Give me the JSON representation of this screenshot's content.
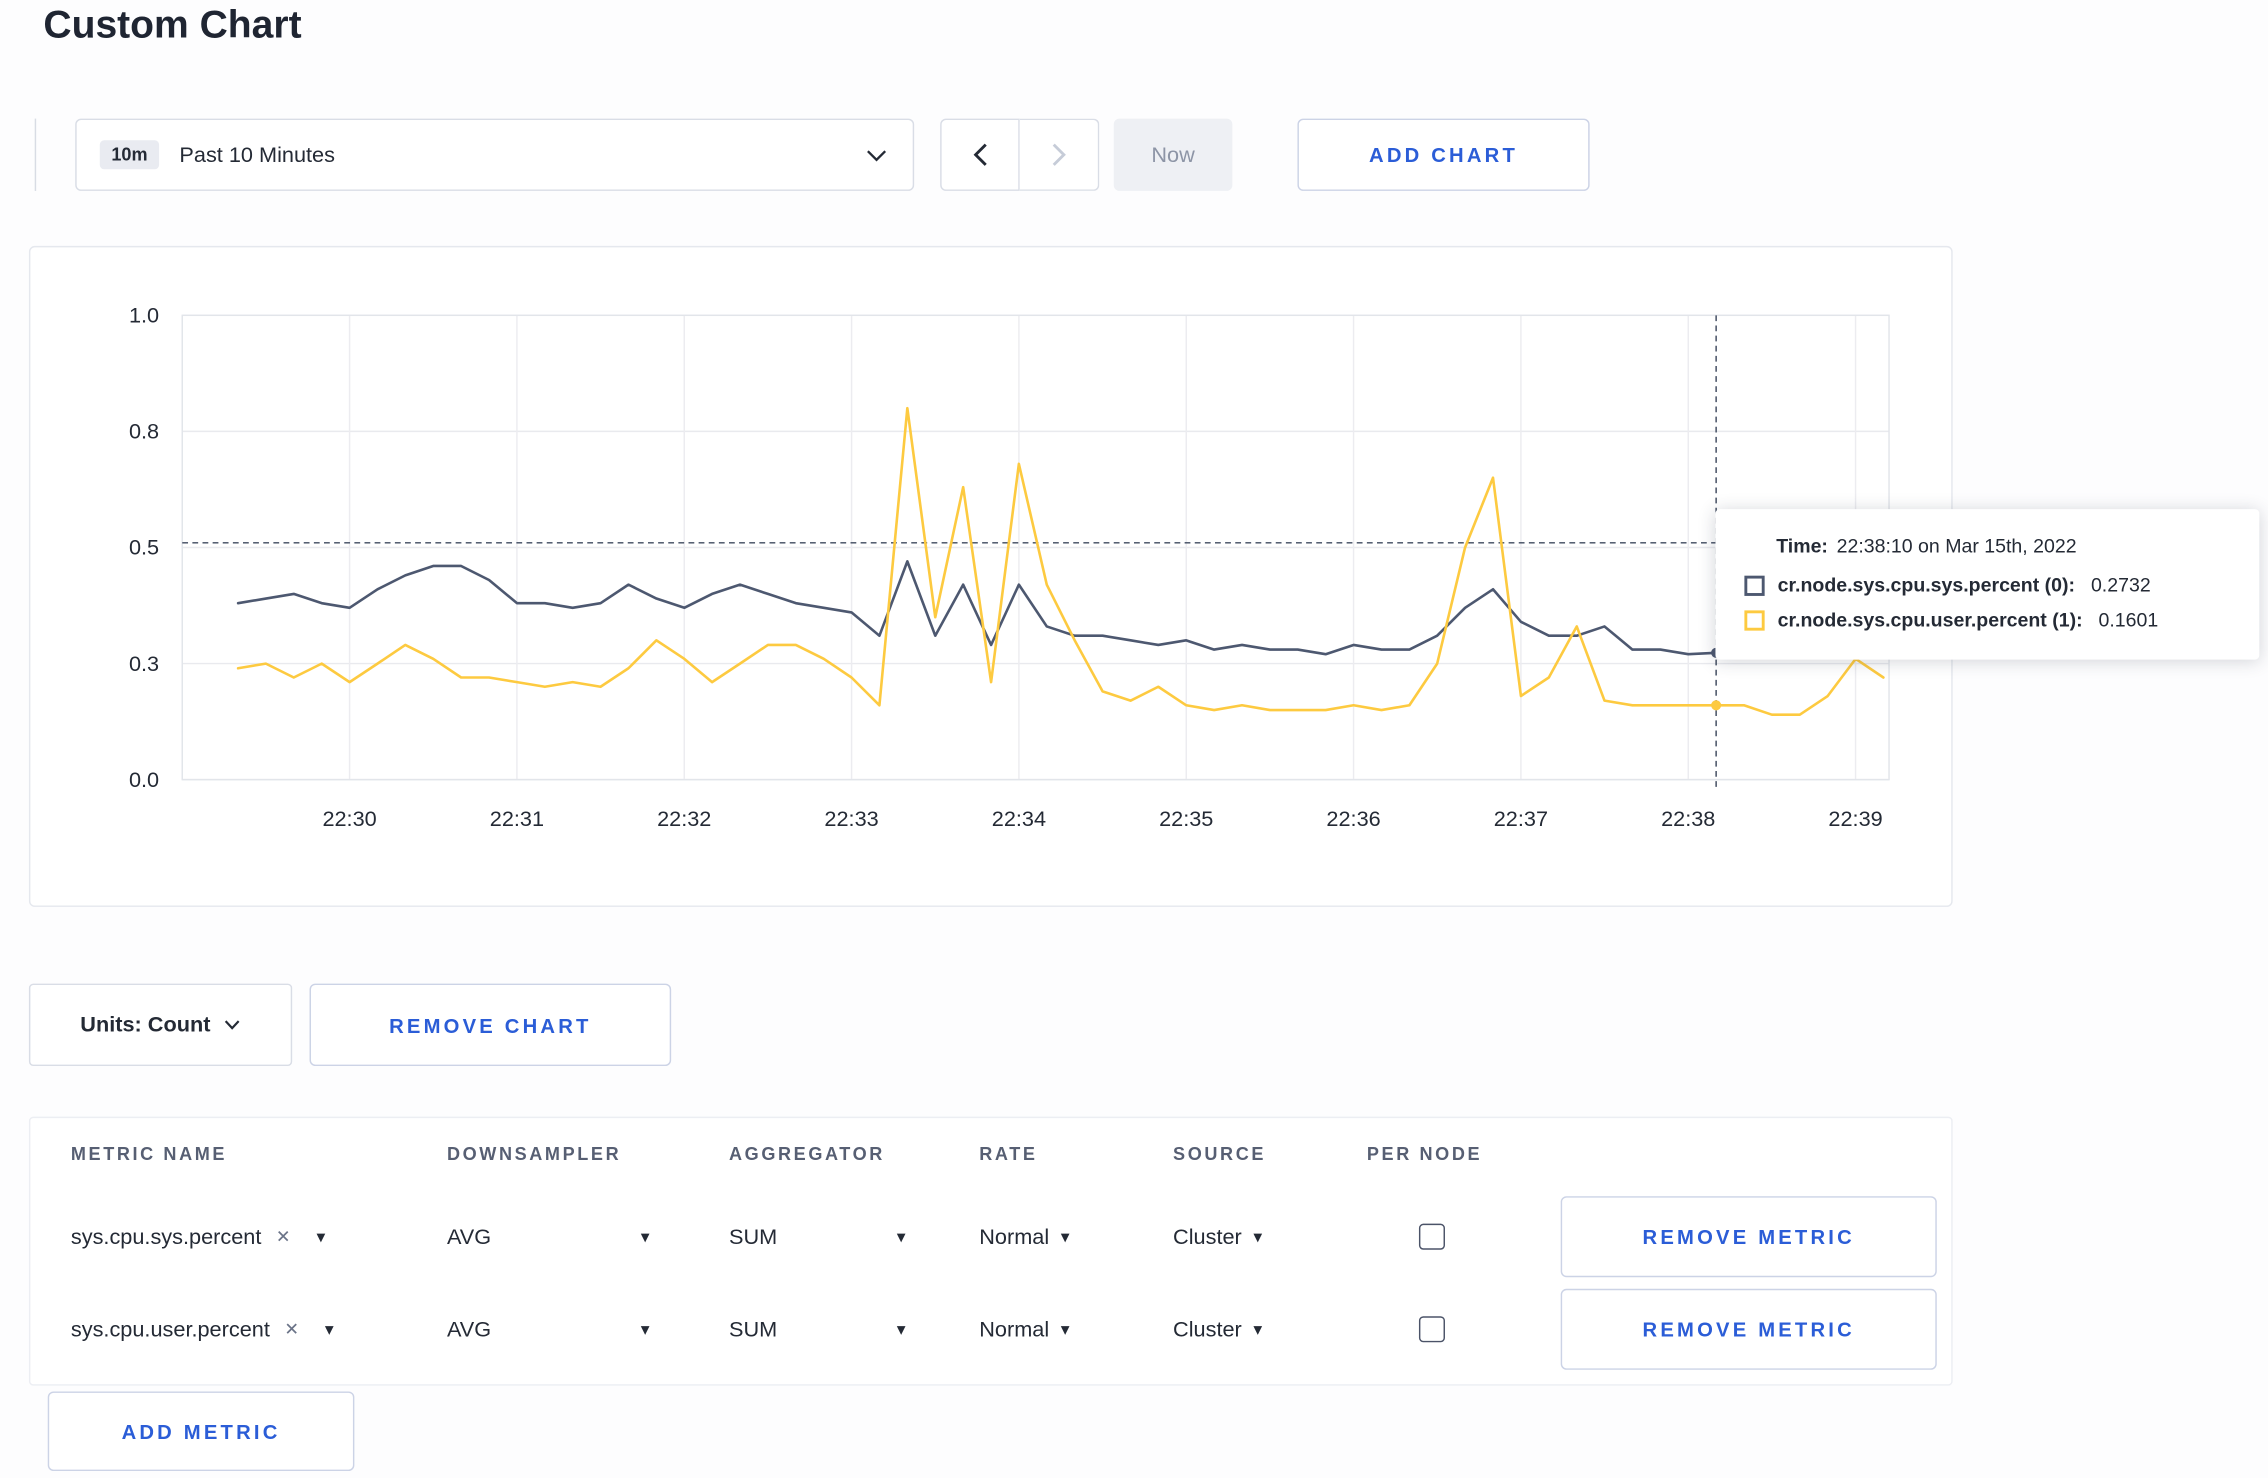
{
  "page": {
    "title": "Custom Chart"
  },
  "colors": {
    "accent_blue": "#2b5dd7",
    "series_sys": "#4d5870",
    "series_user": "#fdca40"
  },
  "icons": {
    "clear": "✕",
    "caret_down": "▾"
  },
  "toolbar": {
    "range_badge": "10m",
    "range_label": "Past 10 Minutes",
    "now_label": "Now",
    "add_chart_label": "ADD CHART"
  },
  "chart_controls": {
    "units_label": "Units: Count",
    "remove_chart_label": "REMOVE CHART"
  },
  "tooltip": {
    "time_label": "Time:",
    "time_value": "22:38:10 on Mar 15th, 2022",
    "series": [
      {
        "name": "cr.node.sys.cpu.sys.percent (0):",
        "value": "0.2732",
        "color": "#4d5870"
      },
      {
        "name": "cr.node.sys.cpu.user.percent (1):",
        "value": "0.1601",
        "color": "#fdca40"
      }
    ]
  },
  "chart_data": {
    "type": "line",
    "title": "",
    "xlabel": "",
    "ylabel": "",
    "ylim": [
      0,
      1
    ],
    "grid": true,
    "legend": "none",
    "y_ticks": {
      "labels": [
        "1.0",
        "0.8",
        "0.5",
        "0.3",
        "0.0"
      ],
      "values": [
        1.0,
        0.75,
        0.5,
        0.25,
        0.0
      ]
    },
    "x_ticks": [
      "22:30",
      "22:31",
      "22:32",
      "22:33",
      "22:34",
      "22:35",
      "22:36",
      "22:37",
      "22:38",
      "22:39"
    ],
    "x_domain": [
      "22:29:00",
      "22:39:12"
    ],
    "x": [
      "22:29:20",
      "22:29:30",
      "22:29:40",
      "22:29:50",
      "22:30:00",
      "22:30:10",
      "22:30:20",
      "22:30:30",
      "22:30:40",
      "22:30:50",
      "22:31:00",
      "22:31:10",
      "22:31:20",
      "22:31:30",
      "22:31:40",
      "22:31:50",
      "22:32:00",
      "22:32:10",
      "22:32:20",
      "22:32:30",
      "22:32:40",
      "22:32:50",
      "22:33:00",
      "22:33:10",
      "22:33:20",
      "22:33:30",
      "22:33:40",
      "22:33:50",
      "22:34:00",
      "22:34:10",
      "22:34:20",
      "22:34:30",
      "22:34:40",
      "22:34:50",
      "22:35:00",
      "22:35:10",
      "22:35:20",
      "22:35:30",
      "22:35:40",
      "22:35:50",
      "22:36:00",
      "22:36:10",
      "22:36:20",
      "22:36:30",
      "22:36:40",
      "22:36:50",
      "22:37:00",
      "22:37:10",
      "22:37:20",
      "22:37:30",
      "22:37:40",
      "22:37:50",
      "22:38:00",
      "22:38:10",
      "22:38:20",
      "22:38:30",
      "22:38:40",
      "22:38:50",
      "22:39:00",
      "22:39:10"
    ],
    "series": [
      {
        "name": "cr.node.sys.cpu.sys.percent",
        "color": "#4d5870",
        "values": [
          0.38,
          0.39,
          0.4,
          0.38,
          0.37,
          0.41,
          0.44,
          0.46,
          0.46,
          0.43,
          0.38,
          0.38,
          0.37,
          0.38,
          0.42,
          0.39,
          0.37,
          0.4,
          0.42,
          0.4,
          0.38,
          0.37,
          0.36,
          0.31,
          0.47,
          0.31,
          0.42,
          0.29,
          0.42,
          0.33,
          0.31,
          0.31,
          0.3,
          0.29,
          0.3,
          0.28,
          0.29,
          0.28,
          0.28,
          0.27,
          0.29,
          0.28,
          0.28,
          0.31,
          0.37,
          0.41,
          0.34,
          0.31,
          0.31,
          0.33,
          0.28,
          0.28,
          0.27,
          0.2732,
          0.3,
          0.31,
          0.31,
          0.3,
          0.3,
          0.31
        ]
      },
      {
        "name": "cr.node.sys.cpu.user.percent",
        "color": "#fdca40",
        "values": [
          0.24,
          0.25,
          0.22,
          0.25,
          0.21,
          0.25,
          0.29,
          0.26,
          0.22,
          0.22,
          0.21,
          0.2,
          0.21,
          0.2,
          0.24,
          0.3,
          0.26,
          0.21,
          0.25,
          0.29,
          0.29,
          0.26,
          0.22,
          0.16,
          0.8,
          0.35,
          0.63,
          0.21,
          0.68,
          0.42,
          0.3,
          0.19,
          0.17,
          0.2,
          0.16,
          0.15,
          0.16,
          0.15,
          0.15,
          0.15,
          0.16,
          0.15,
          0.16,
          0.25,
          0.5,
          0.65,
          0.18,
          0.22,
          0.33,
          0.17,
          0.16,
          0.16,
          0.16,
          0.1601,
          0.16,
          0.14,
          0.14,
          0.18,
          0.26,
          0.22
        ]
      }
    ],
    "crosshair": {
      "time": "22:38:10",
      "hover_y": 0.51,
      "values": [
        0.2732,
        0.1601
      ]
    }
  },
  "metrics_table": {
    "headers": [
      "METRIC NAME",
      "DOWNSAMPLER",
      "AGGREGATOR",
      "RATE",
      "SOURCE",
      "PER NODE"
    ],
    "rows": [
      {
        "metric": "sys.cpu.sys.percent",
        "downsampler": "AVG",
        "aggregator": "SUM",
        "rate": "Normal",
        "source": "Cluster",
        "per_node": false,
        "remove_label": "REMOVE METRIC"
      },
      {
        "metric": "sys.cpu.user.percent",
        "downsampler": "AVG",
        "aggregator": "SUM",
        "rate": "Normal",
        "source": "Cluster",
        "per_node": false,
        "remove_label": "REMOVE METRIC"
      }
    ],
    "add_metric_label": "ADD METRIC"
  }
}
